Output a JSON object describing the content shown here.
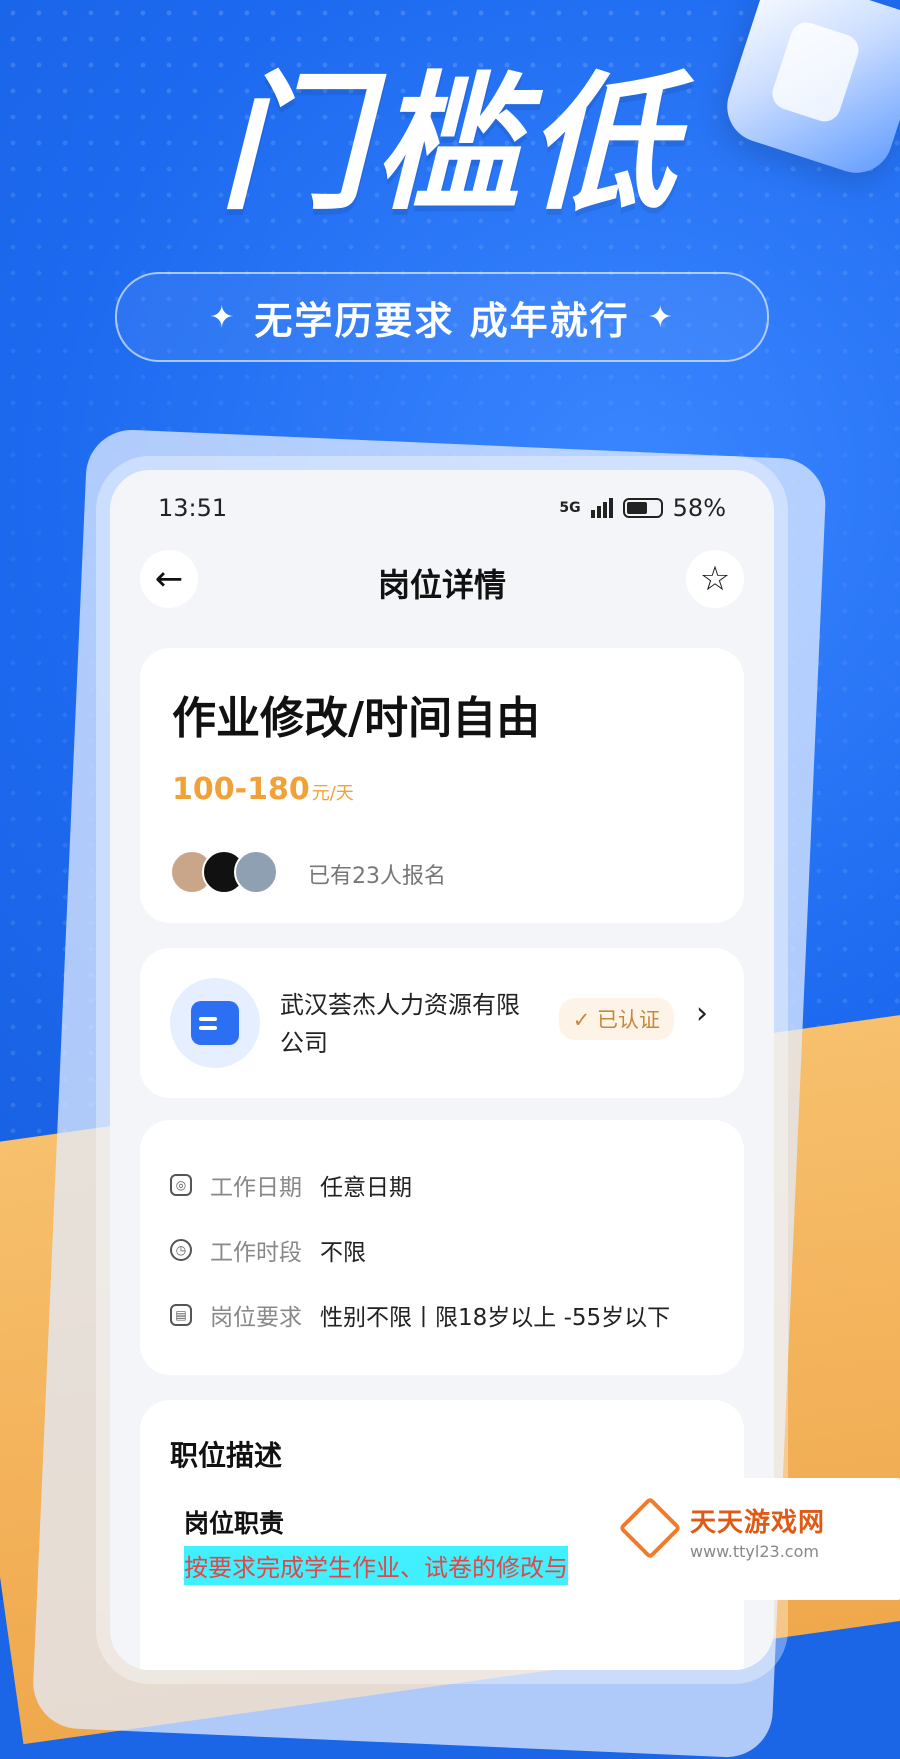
{
  "hero": {
    "title": "门槛低",
    "subtitle": "无学历要求 成年就行",
    "sparkle": "✦"
  },
  "status_bar": {
    "time": "13:51",
    "network": "5G",
    "battery": "58%"
  },
  "nav": {
    "title": "岗位详情",
    "back_icon": "←",
    "star_icon": "☆"
  },
  "job": {
    "title": "作业修改/时间自由",
    "salary": "100-180",
    "salary_unit": "元/天",
    "signup_text": "已有23人报名"
  },
  "company": {
    "name": "武汉荟杰人力资源有限公司",
    "verified": "✓ 已认证",
    "chevron": "›"
  },
  "details": [
    {
      "label": "工作日期",
      "value": "任意日期"
    },
    {
      "label": "工作时段",
      "value": "不限"
    },
    {
      "label": "岗位要求",
      "value": "性别不限丨限18岁以上 -55岁以下"
    }
  ],
  "description": {
    "title": "职位描述",
    "duty_title": "岗位职责",
    "duty_text": "按要求完成学生作业、试卷的修改与"
  },
  "watermark": {
    "name": "天天游戏网",
    "url": "www.ttyl23.com"
  }
}
